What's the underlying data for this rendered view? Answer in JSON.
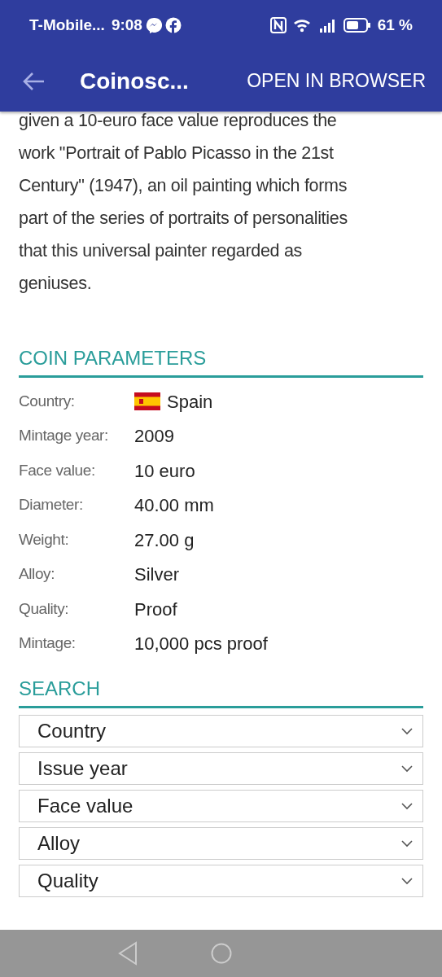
{
  "status_bar": {
    "carrier": "T-Mobile...",
    "time": "9:08",
    "battery": "61 %"
  },
  "app_bar": {
    "title": "Coinosc...",
    "action": "OPEN IN BROWSER"
  },
  "description": {
    "lines": [
      "given a 10-euro face value reproduces the",
      "work \"Portrait of Pablo Picasso in the 21st",
      "Century\" (1947), an oil painting which forms",
      "part of the series of portraits of personalities",
      "that this universal painter regarded as",
      "geniuses."
    ]
  },
  "coin_parameters": {
    "title": "COIN PARAMETERS",
    "rows": [
      {
        "label": "Country:",
        "value": "Spain",
        "kind": "flag"
      },
      {
        "label": "Mintage year:",
        "value": "2009",
        "kind": "text"
      },
      {
        "label": "Face value:",
        "value": "10 euro",
        "kind": "text"
      },
      {
        "label": "Diameter:",
        "value": "40.00 mm",
        "kind": "text"
      },
      {
        "label": "Weight:",
        "value": "27.00 g",
        "kind": "text"
      },
      {
        "label": "Alloy:",
        "value": "Silver",
        "kind": "text"
      },
      {
        "label": "Quality:",
        "value": "Proof",
        "kind": "text"
      },
      {
        "label": "Mintage:",
        "value": "10,000 pcs proof",
        "kind": "text"
      }
    ]
  },
  "search": {
    "title": "SEARCH",
    "selects": [
      "Country",
      "Issue year",
      "Face value",
      "Alloy",
      "Quality"
    ]
  }
}
